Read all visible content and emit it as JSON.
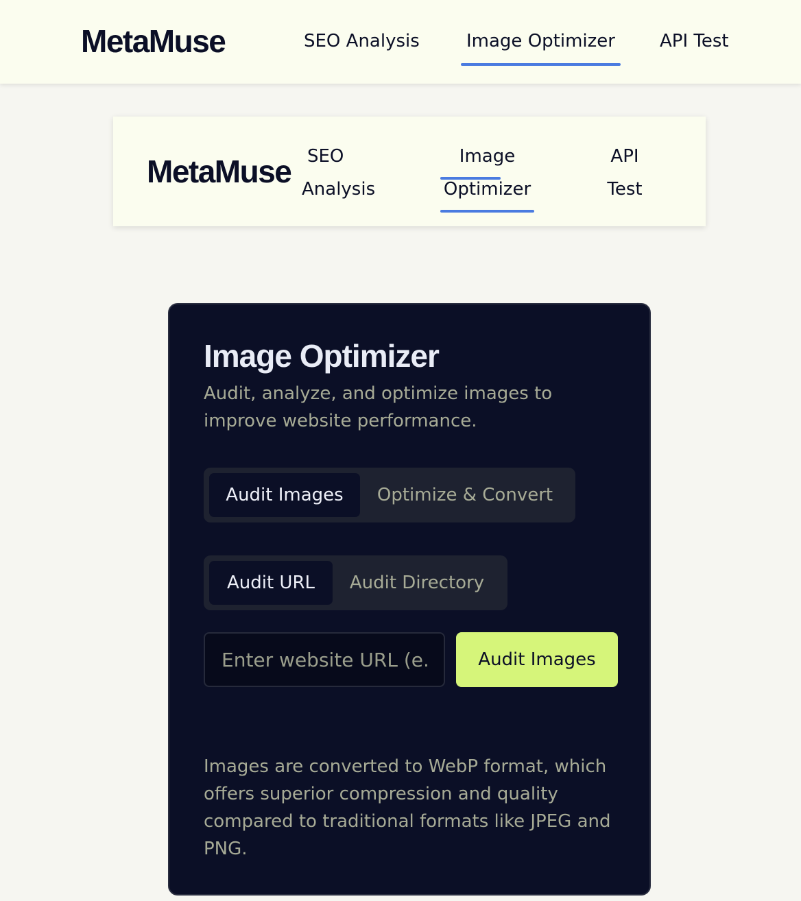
{
  "top_header": {
    "logo": "MetaMuse",
    "nav": [
      {
        "label": "SEO Analysis"
      },
      {
        "label": "Image Optimizer"
      },
      {
        "label": "API Test"
      }
    ],
    "active_nav": "Image Optimizer"
  },
  "card_header": {
    "logo": "MetaMuse",
    "nav": [
      {
        "line1": "SEO",
        "line2": "Analysis"
      },
      {
        "line1": "Image",
        "line2": "Optimizer"
      },
      {
        "line1": "API",
        "line2": "Test"
      }
    ],
    "active_nav": "Image Optimizer"
  },
  "panel": {
    "title": "Image Optimizer",
    "subtitle": "Audit, analyze, and optimize images to improve website performance.",
    "mode_tabs": [
      {
        "label": "Audit Images",
        "active": true
      },
      {
        "label": "Optimize & Convert",
        "active": false
      }
    ],
    "source_tabs": [
      {
        "label": "Audit URL",
        "active": true
      },
      {
        "label": "Audit Directory",
        "active": false
      }
    ],
    "url_input": {
      "placeholder": "Enter website URL (e.g., https://example.com)",
      "value": ""
    },
    "submit_label": "Audit Images",
    "note": "Images are converted to WebP format, which offers superior compression and quality compared to traditional formats like JPEG and PNG."
  },
  "colors": {
    "page_bg": "#f6f6f1",
    "header_bg": "#fbfdef",
    "panel_bg": "#0b0f26",
    "accent_underline": "#4a7be0",
    "primary_button": "#d6f57a",
    "muted_text": "#a7ab96"
  }
}
